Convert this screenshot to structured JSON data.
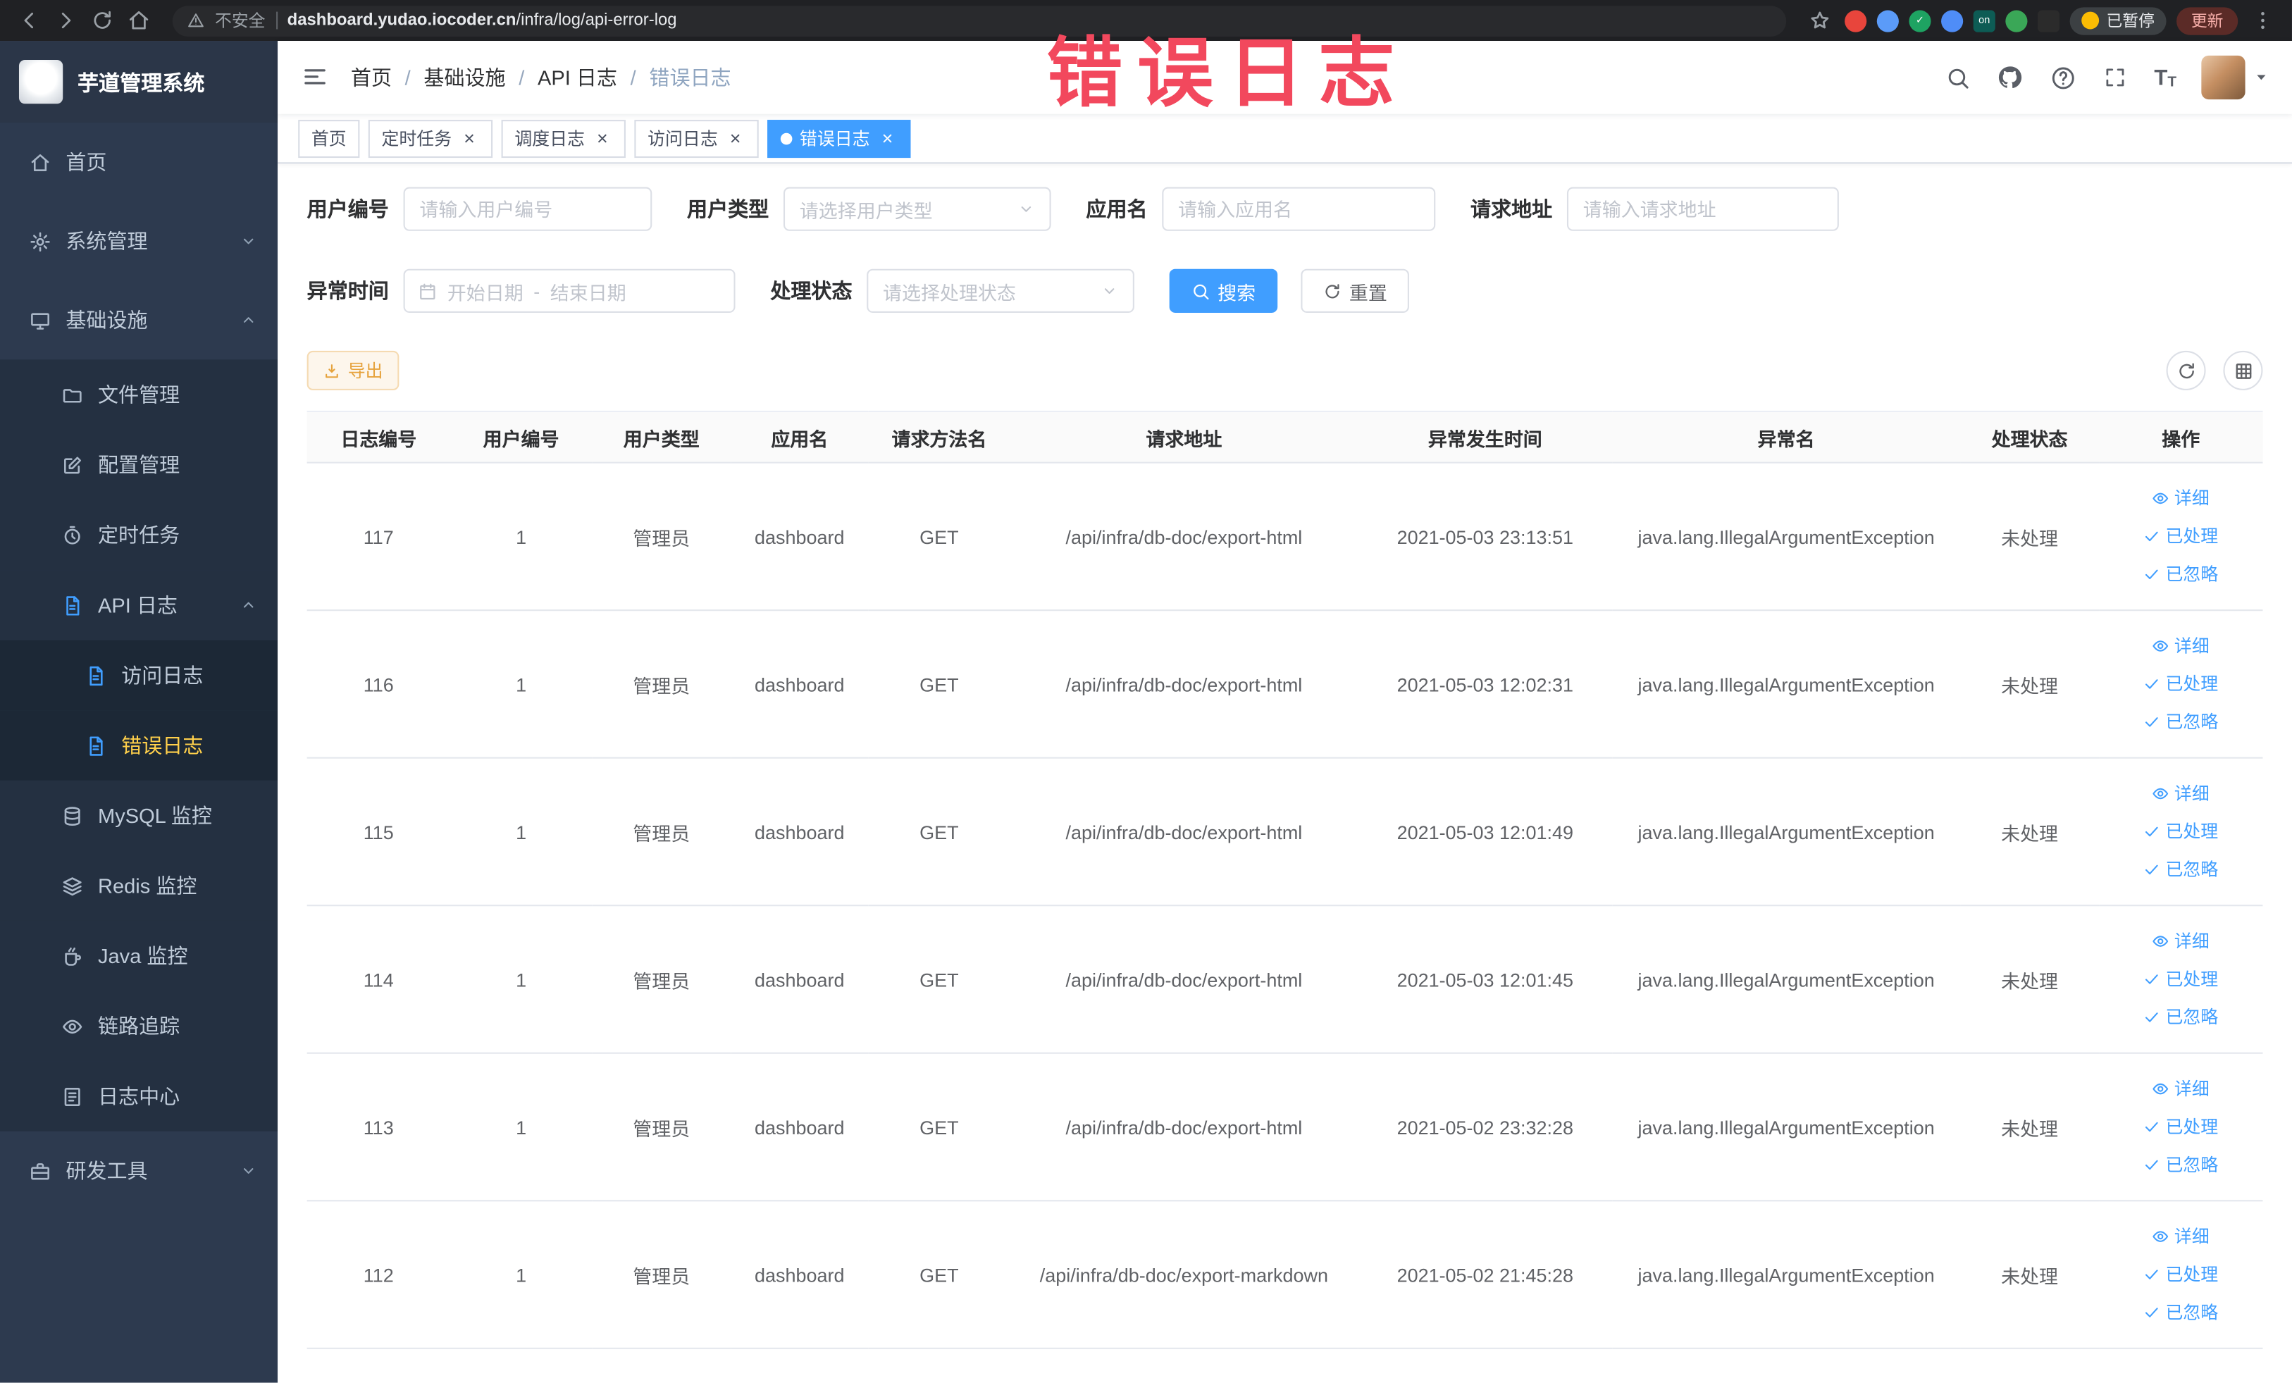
{
  "annotation": {
    "text": "错误日志",
    "color": "#f2485d"
  },
  "browser": {
    "security_label": "不安全",
    "url_domain": "dashboard.yudao.iocoder.cn",
    "url_path": "/infra/log/api-error-log",
    "paused_badge": "已暂停",
    "update_label": "更新",
    "extensions": [
      {
        "name": "extension-red-circle",
        "color": "#e8453c"
      },
      {
        "name": "extension-blue-drop",
        "color": "#5b9bf8"
      },
      {
        "name": "extension-green-check",
        "color": "#1ea362",
        "glyph": "✓"
      },
      {
        "name": "extension-blue-grid",
        "color": "#4f8df7"
      },
      {
        "name": "extension-on-switch",
        "color": "#0d5c55",
        "text": "on",
        "shape": "square"
      },
      {
        "name": "extension-green-leaf",
        "color": "#3aa757"
      },
      {
        "name": "extension-dark-square",
        "color": "#2b2b2b",
        "shape": "square"
      }
    ]
  },
  "sidebar": {
    "logo_title": "芋道管理系统",
    "menu": [
      {
        "label": "首页",
        "icon": "home-icon",
        "level": 1
      },
      {
        "label": "系统管理",
        "icon": "gear-icon",
        "level": 1,
        "chevron": "down"
      },
      {
        "label": "基础设施",
        "icon": "monitor-icon",
        "level": 1,
        "chevron": "up"
      },
      {
        "label": "文件管理",
        "icon": "folder-icon",
        "level": 2
      },
      {
        "label": "配置管理",
        "icon": "edit-icon",
        "level": 2
      },
      {
        "label": "定时任务",
        "icon": "clock-icon",
        "level": 2
      },
      {
        "label": "API 日志",
        "icon": "doc-icon",
        "level": 2,
        "chevron": "up",
        "icon_color": "#409eff"
      },
      {
        "label": "访问日志",
        "icon": "doc-icon",
        "level": 3,
        "icon_color": "#409eff"
      },
      {
        "label": "错误日志",
        "icon": "doc-icon",
        "level": 3,
        "icon_color": "#409eff",
        "active": true
      },
      {
        "label": "MySQL 监控",
        "icon": "database-icon",
        "level": 2
      },
      {
        "label": "Redis 监控",
        "icon": "layers-icon",
        "level": 2
      },
      {
        "label": "Java 监控",
        "icon": "coffee-icon",
        "level": 2
      },
      {
        "label": "链路追踪",
        "icon": "eye-icon",
        "level": 2
      },
      {
        "label": "日志中心",
        "icon": "list-icon",
        "level": 2
      },
      {
        "label": "研发工具",
        "icon": "briefcase-icon",
        "level": 1,
        "chevron": "down"
      }
    ]
  },
  "header": {
    "breadcrumb": [
      "首页",
      "基础设施",
      "API 日志",
      "错误日志"
    ]
  },
  "tabs": [
    {
      "label": "首页",
      "closable": false,
      "active": false
    },
    {
      "label": "定时任务",
      "closable": true,
      "active": false
    },
    {
      "label": "调度日志",
      "closable": true,
      "active": false
    },
    {
      "label": "访问日志",
      "closable": true,
      "active": false
    },
    {
      "label": "错误日志",
      "closable": true,
      "active": true
    }
  ],
  "filters": {
    "user_id": {
      "label": "用户编号",
      "placeholder": "请输入用户编号"
    },
    "user_type": {
      "label": "用户类型",
      "placeholder": "请选择用户类型"
    },
    "app_name": {
      "label": "应用名",
      "placeholder": "请输入应用名"
    },
    "request_url": {
      "label": "请求地址",
      "placeholder": "请输入请求地址"
    },
    "exception_time": {
      "label": "异常时间",
      "start_placeholder": "开始日期",
      "separator": "-",
      "end_placeholder": "结束日期"
    },
    "process_status": {
      "label": "处理状态",
      "placeholder": "请选择处理状态"
    },
    "search_label": "搜索",
    "reset_label": "重置"
  },
  "toolbar": {
    "export_label": "导出"
  },
  "table": {
    "columns": [
      "日志编号",
      "用户编号",
      "用户类型",
      "应用名",
      "请求方法名",
      "请求地址",
      "异常发生时间",
      "异常名",
      "处理状态",
      "操作"
    ],
    "rows": [
      {
        "id": "117",
        "user_id": "1",
        "user_type": "管理员",
        "app": "dashboard",
        "method": "GET",
        "url": "/api/infra/db-doc/export-html",
        "time": "2021-05-03 23:13:51",
        "exception": "java.lang.IllegalArgumentException",
        "status": "未处理"
      },
      {
        "id": "116",
        "user_id": "1",
        "user_type": "管理员",
        "app": "dashboard",
        "method": "GET",
        "url": "/api/infra/db-doc/export-html",
        "time": "2021-05-03 12:02:31",
        "exception": "java.lang.IllegalArgumentException",
        "status": "未处理"
      },
      {
        "id": "115",
        "user_id": "1",
        "user_type": "管理员",
        "app": "dashboard",
        "method": "GET",
        "url": "/api/infra/db-doc/export-html",
        "time": "2021-05-03 12:01:49",
        "exception": "java.lang.IllegalArgumentException",
        "status": "未处理"
      },
      {
        "id": "114",
        "user_id": "1",
        "user_type": "管理员",
        "app": "dashboard",
        "method": "GET",
        "url": "/api/infra/db-doc/export-html",
        "time": "2021-05-03 12:01:45",
        "exception": "java.lang.IllegalArgumentException",
        "status": "未处理"
      },
      {
        "id": "113",
        "user_id": "1",
        "user_type": "管理员",
        "app": "dashboard",
        "method": "GET",
        "url": "/api/infra/db-doc/export-html",
        "time": "2021-05-02 23:32:28",
        "exception": "java.lang.IllegalArgumentException",
        "status": "未处理"
      },
      {
        "id": "112",
        "user_id": "1",
        "user_type": "管理员",
        "app": "dashboard",
        "method": "GET",
        "url": "/api/infra/db-doc/export-markdown",
        "time": "2021-05-02 21:45:28",
        "exception": "java.lang.IllegalArgumentException",
        "status": "未处理"
      }
    ],
    "row_actions": [
      "详细",
      "已处理",
      "已忽略"
    ]
  },
  "colors": {
    "accent": "#409eff",
    "active_menu_text": "#ffd04b",
    "warning": "#e6a23c"
  }
}
